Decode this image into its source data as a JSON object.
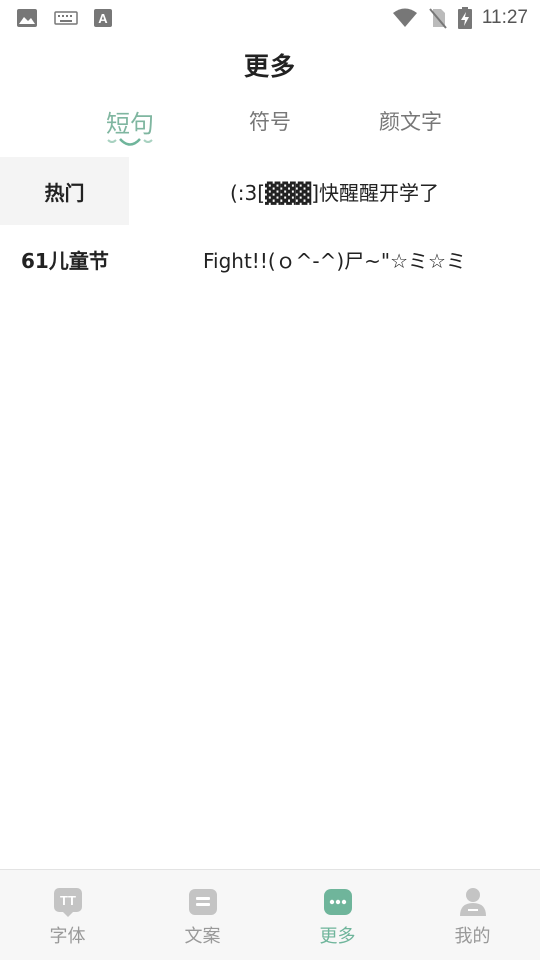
{
  "status_bar": {
    "time": "11:27",
    "left_icons": [
      "image-icon",
      "keyboard-icon",
      "font-icon"
    ],
    "right_icons": [
      "wifi-icon",
      "no-sim-icon",
      "battery-charging-icon"
    ]
  },
  "header": {
    "title": "更多"
  },
  "tabs": [
    {
      "label": "短句",
      "active": true
    },
    {
      "label": "符号",
      "active": false
    },
    {
      "label": "颜文字",
      "active": false
    }
  ],
  "categories": [
    {
      "label": "热门",
      "active": true
    },
    {
      "label": "61儿童节",
      "active": false
    }
  ],
  "phrases": [
    "(:3[▓▓▓]快醒醒开学了",
    "Fight!!(ｏ^-^)尸~\"☆ミ☆ミ"
  ],
  "bottom_nav": [
    {
      "label": "字体",
      "icon": "font-tt-icon",
      "active": false
    },
    {
      "label": "文案",
      "icon": "copywriting-icon",
      "active": false
    },
    {
      "label": "更多",
      "icon": "more-dots-icon",
      "active": true
    },
    {
      "label": "我的",
      "icon": "profile-icon",
      "active": false
    }
  ],
  "colors": {
    "accent": "#6fb59b",
    "tab_active": "#7fb6a0",
    "nav_inactive": "#999999",
    "category_active_bg": "#f4f4f4"
  }
}
